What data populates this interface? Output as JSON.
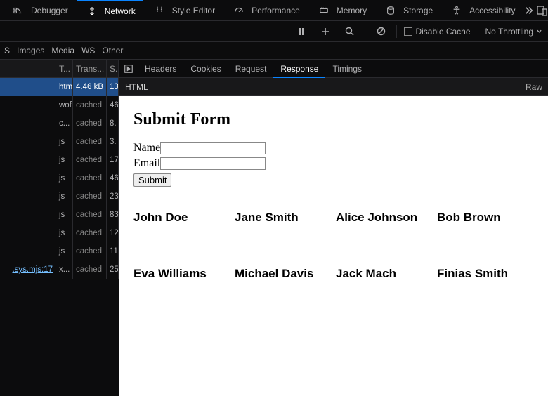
{
  "toolTabs": {
    "debugger": "Debugger",
    "network": "Network",
    "style": "Style Editor",
    "perf": "Performance",
    "memory": "Memory",
    "storage": "Storage",
    "access": "Accessibility"
  },
  "actionBar": {
    "disableCache": "Disable Cache",
    "throttle": "No Throttling"
  },
  "filters": {
    "s": "S",
    "images": "Images",
    "media": "Media",
    "ws": "WS",
    "other": "Other"
  },
  "gridHead": {
    "t": "T...",
    "tr": "Trans...",
    "s": "S..."
  },
  "rows": [
    {
      "file": "",
      "type": "htm",
      "trans": "4.46 kB",
      "s": "13"
    },
    {
      "file": "",
      "type": "wof",
      "trans": "cached",
      "s": "46"
    },
    {
      "file": "",
      "type": "c...",
      "trans": "cached",
      "s": "8."
    },
    {
      "file": "",
      "type": "js",
      "trans": "cached",
      "s": "3."
    },
    {
      "file": "",
      "type": "js",
      "trans": "cached",
      "s": "17"
    },
    {
      "file": "",
      "type": "js",
      "trans": "cached",
      "s": "46"
    },
    {
      "file": "",
      "type": "js",
      "trans": "cached",
      "s": "23"
    },
    {
      "file": "",
      "type": "js",
      "trans": "cached",
      "s": "83"
    },
    {
      "file": "",
      "type": "js",
      "trans": "cached",
      "s": "12"
    },
    {
      "file": "",
      "type": "js",
      "trans": "cached",
      "s": "11"
    },
    {
      "file": ".sys.mjs:17",
      "type": "x...",
      "trans": "cached",
      "s": "25"
    }
  ],
  "detailTabs": {
    "headers": "Headers",
    "cookies": "Cookies",
    "request": "Request",
    "response": "Response",
    "timings": "Timings"
  },
  "subBar": {
    "label": "HTML",
    "raw": "Raw"
  },
  "preview": {
    "title": "Submit Form",
    "nameLabel": "Name",
    "emailLabel": "Email",
    "submit": "Submit",
    "people": [
      "John Doe",
      "Jane Smith",
      "Alice Johnson",
      "Bob Brown",
      "Eva Williams",
      "Michael Davis",
      "Jack Mach",
      "Finias Smith"
    ]
  }
}
